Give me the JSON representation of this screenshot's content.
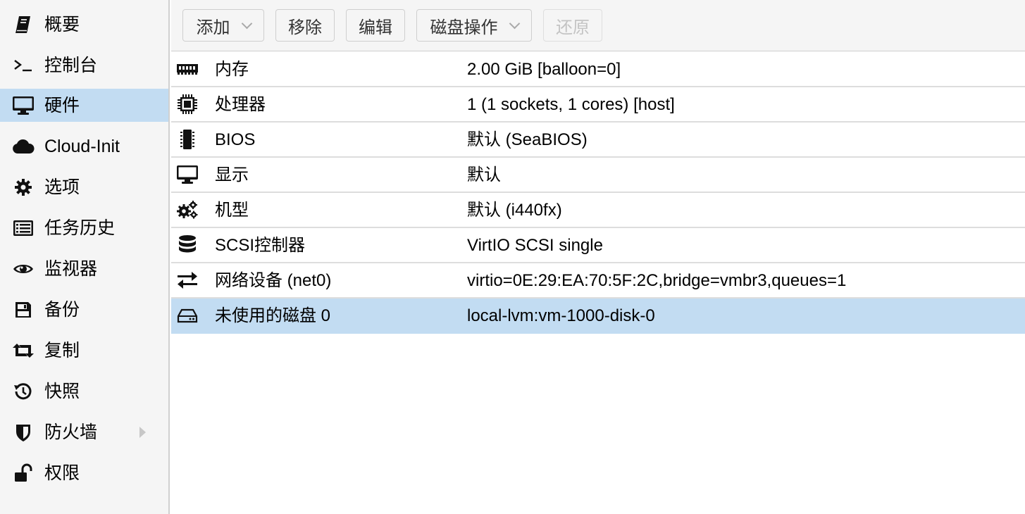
{
  "sidebar": {
    "items": [
      {
        "label": "概要",
        "icon": "book-icon"
      },
      {
        "label": "控制台",
        "icon": "terminal-icon"
      },
      {
        "label": "硬件",
        "icon": "desktop-icon",
        "selected": true
      },
      {
        "label": "Cloud-Init",
        "icon": "cloud-icon"
      },
      {
        "label": "选项",
        "icon": "gear-icon"
      },
      {
        "label": "任务历史",
        "icon": "list-icon"
      },
      {
        "label": "监视器",
        "icon": "eye-icon"
      },
      {
        "label": "备份",
        "icon": "floppy-icon"
      },
      {
        "label": "复制",
        "icon": "retweet-icon"
      },
      {
        "label": "快照",
        "icon": "history-icon"
      },
      {
        "label": "防火墙",
        "icon": "shield-icon",
        "has_submenu": true
      },
      {
        "label": "权限",
        "icon": "unlock-icon"
      }
    ]
  },
  "toolbar": {
    "add_label": "添加",
    "remove_label": "移除",
    "edit_label": "编辑",
    "disk_action_label": "磁盘操作",
    "revert_label": "还原"
  },
  "hardware": {
    "rows": [
      {
        "name": "内存",
        "value": "2.00 GiB [balloon=0]",
        "icon": "memory-icon"
      },
      {
        "name": "处理器",
        "value": "1 (1 sockets, 1 cores) [host]",
        "icon": "cpu-icon"
      },
      {
        "name": "BIOS",
        "value": "默认 (SeaBIOS)",
        "icon": "microchip-icon"
      },
      {
        "name": "显示",
        "value": "默认",
        "icon": "desktop-icon"
      },
      {
        "name": "机型",
        "value": "默认 (i440fx)",
        "icon": "cogs-icon"
      },
      {
        "name": "SCSI控制器",
        "value": "VirtIO SCSI single",
        "icon": "database-icon"
      },
      {
        "name": "网络设备 (net0)",
        "value": "virtio=0E:29:EA:70:5F:2C,bridge=vmbr3,queues=1",
        "icon": "exchange-icon"
      },
      {
        "name": "未使用的磁盘 0",
        "value": "local-lvm:vm-1000-disk-0",
        "icon": "hdd-icon",
        "selected": true
      }
    ]
  },
  "colors": {
    "selection": "#c2dcf2",
    "sidebar_bg": "#f5f5f5"
  }
}
